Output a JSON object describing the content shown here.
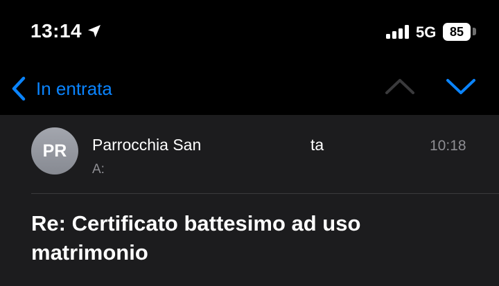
{
  "status_bar": {
    "time": "13:14",
    "location_icon": "location-arrow-icon",
    "signal_icon": "cellular-signal-icon",
    "network": "5G",
    "battery": "85"
  },
  "nav": {
    "back_label": "In entrata",
    "back_icon": "chevron-left-icon",
    "prev_icon": "chevron-up-icon",
    "next_icon": "chevron-down-icon"
  },
  "message": {
    "avatar_initials": "PR",
    "sender_visible_start": "Parrocchia San",
    "sender_visible_end": "ta",
    "to_label": "A:",
    "time": "10:18",
    "subject": "Re: Certificato battesimo ad uso matrimonio"
  },
  "colors": {
    "accent": "#0a84ff",
    "background": "#000000",
    "content_background": "#1c1c1e",
    "secondary_text": "#8e8e93"
  }
}
